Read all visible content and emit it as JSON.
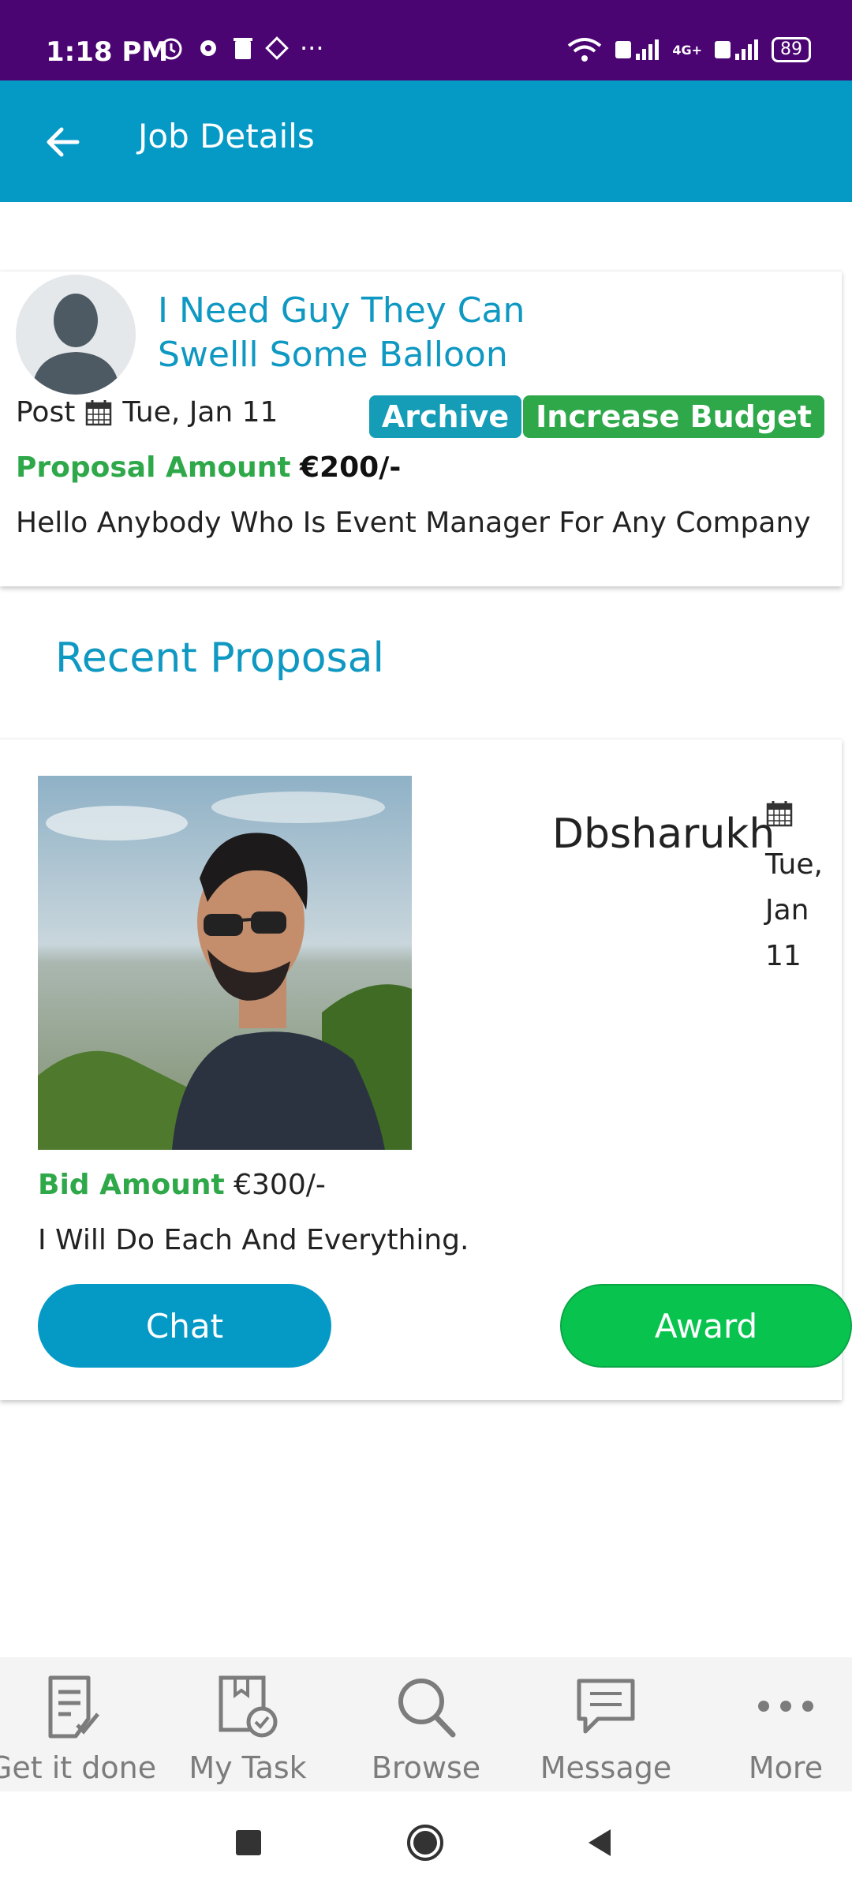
{
  "status_bar": {
    "time": "1:18 PM",
    "more_indicator": "···",
    "network_label": "4G+",
    "battery": "89"
  },
  "app_bar": {
    "title": "Job Details"
  },
  "job": {
    "title": "I Need Guy They Can Swelll Some Balloon",
    "post_label": "Post",
    "post_date": "Tue, Jan 11",
    "archive_label": "Archive",
    "increase_budget_label": "Increase Budget",
    "proposal_amount_label": "Proposal Amount",
    "proposal_amount": "€200/-",
    "description": "Hello Anybody Who Is Event Manager For Any Company"
  },
  "recent_proposal": {
    "section_title": "Recent Proposal",
    "bidder_name": "Dbsharukh",
    "bid_date": "Tue, Jan 11",
    "bid_amount_label": "Bid Amount",
    "bid_amount": "€300/-",
    "message": "I Will Do Each And Everything.",
    "chat_label": "Chat",
    "award_label": "Award"
  },
  "bottom_nav": [
    {
      "label": "Get it done",
      "icon": "checklist-icon"
    },
    {
      "label": "My Task",
      "icon": "task-icon"
    },
    {
      "label": "Browse",
      "icon": "search-icon"
    },
    {
      "label": "Message",
      "icon": "message-icon"
    },
    {
      "label": "More",
      "icon": "more-icon"
    }
  ],
  "colors": {
    "status_bar": "#4a0572",
    "primary": "#059ac6",
    "green": "#2fa84a",
    "award_green": "#08c44f"
  }
}
